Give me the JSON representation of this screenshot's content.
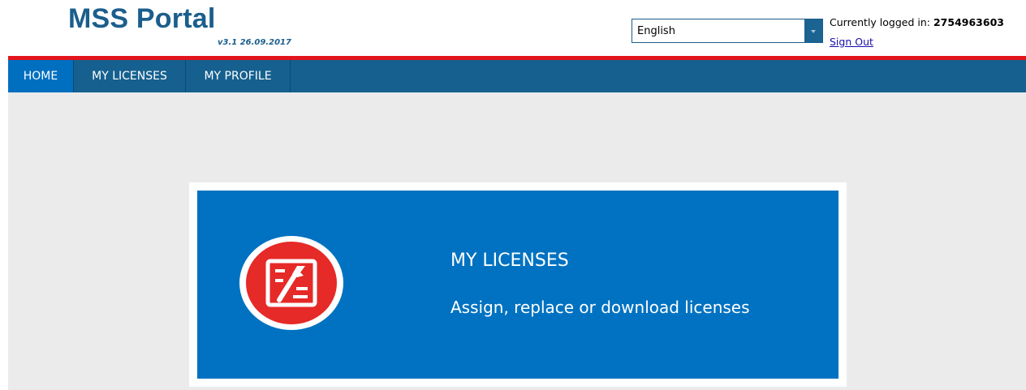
{
  "header": {
    "title": "MSS Portal",
    "version": "v3.1 26.09.2017",
    "language": {
      "selected": "English"
    },
    "login": {
      "label": "Currently logged in:",
      "user_id": "2754963603",
      "sign_out": "Sign Out"
    }
  },
  "nav": {
    "items": [
      {
        "label": "HOME",
        "active": true
      },
      {
        "label": "MY LICENSES",
        "active": false
      },
      {
        "label": "MY PROFILE",
        "active": false
      }
    ]
  },
  "card": {
    "title": "MY LICENSES",
    "description": "Assign, replace or download licenses",
    "icon": "licenses-tools-icon"
  },
  "colors": {
    "brand_blue": "#1b5e8c",
    "nav_bg": "#15608f",
    "nav_active": "#006fc0",
    "accent_red": "#e3141c",
    "card_bg": "#0072c1",
    "page_bg": "#ebebeb"
  }
}
